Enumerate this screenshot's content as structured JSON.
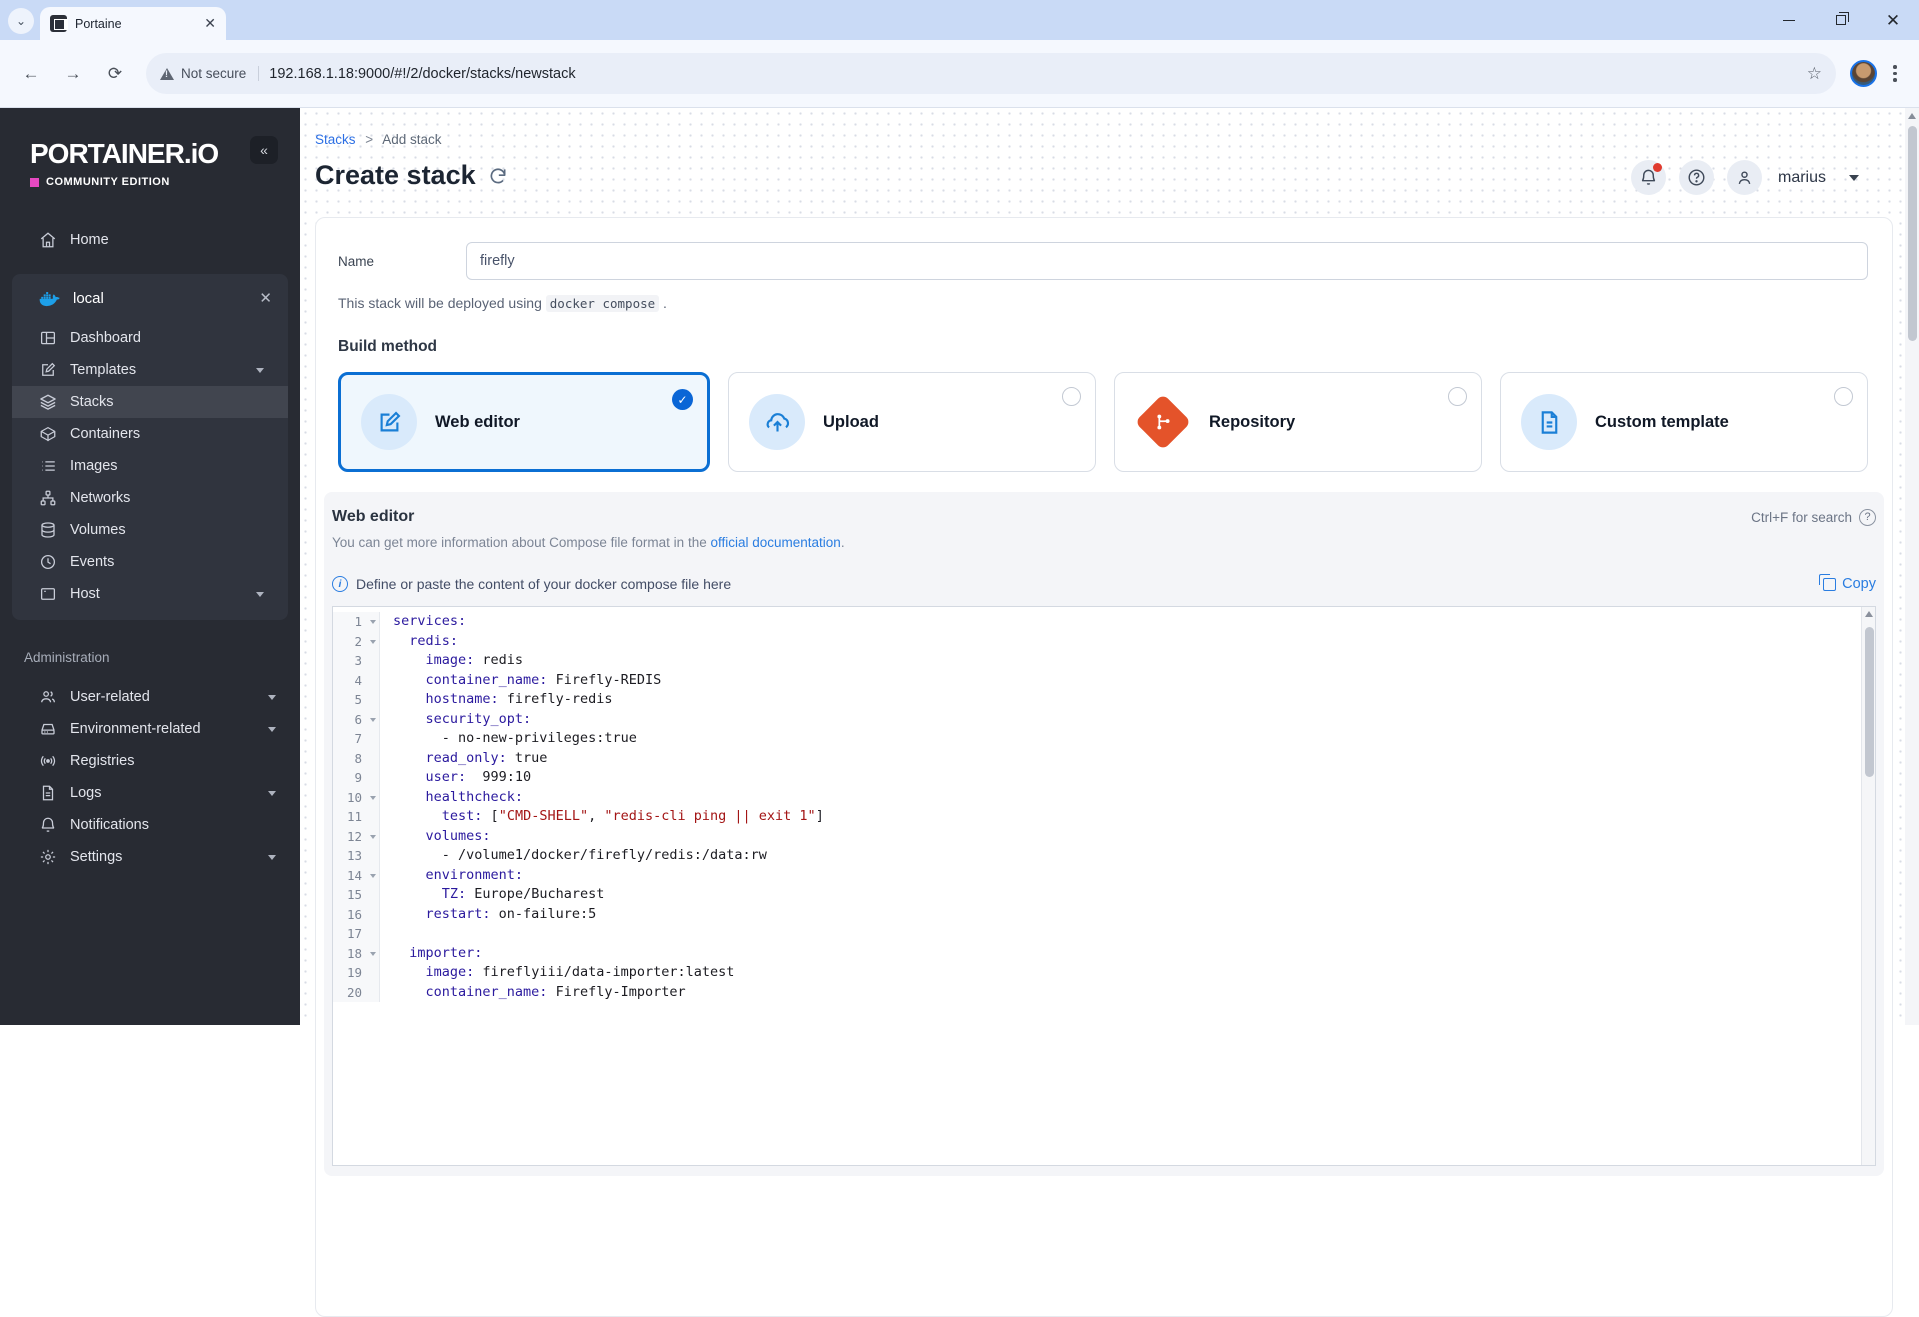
{
  "browser": {
    "tab_title": "Portaine",
    "not_secure": "Not secure",
    "url": "192.168.1.18:9000/#!/2/docker/stacks/newstack"
  },
  "sidebar": {
    "logo": "PORTAINER.iO",
    "edition": "COMMUNITY EDITION",
    "home": "Home",
    "env_name": "local",
    "env_items": [
      {
        "label": "Dashboard",
        "icon": "dashboard"
      },
      {
        "label": "Templates",
        "icon": "templates",
        "chevron": true
      },
      {
        "label": "Stacks",
        "icon": "stacks",
        "active": true
      },
      {
        "label": "Containers",
        "icon": "containers"
      },
      {
        "label": "Images",
        "icon": "images"
      },
      {
        "label": "Networks",
        "icon": "networks"
      },
      {
        "label": "Volumes",
        "icon": "volumes"
      },
      {
        "label": "Events",
        "icon": "events"
      },
      {
        "label": "Host",
        "icon": "host",
        "chevron": true
      }
    ],
    "admin_label": "Administration",
    "admin_items": [
      {
        "label": "User-related",
        "icon": "users",
        "chevron": true
      },
      {
        "label": "Environment-related",
        "icon": "environments",
        "chevron": true
      },
      {
        "label": "Registries",
        "icon": "registries"
      },
      {
        "label": "Logs",
        "icon": "logs",
        "chevron": true
      },
      {
        "label": "Notifications",
        "icon": "notifications"
      },
      {
        "label": "Settings",
        "icon": "settings",
        "chevron": true
      }
    ]
  },
  "header": {
    "breadcrumb_root": "Stacks",
    "breadcrumb_sep": ">",
    "breadcrumb_current": "Add stack",
    "title": "Create stack",
    "user": "marius"
  },
  "form": {
    "name_label": "Name",
    "name_value": "firefly",
    "deploy_prefix": "This stack will be deployed using ",
    "deploy_code": "docker compose",
    "deploy_suffix": " .",
    "build_method_label": "Build method",
    "methods": [
      {
        "label": "Web editor",
        "icon": "pencil",
        "selected": true
      },
      {
        "label": "Upload",
        "icon": "upload"
      },
      {
        "label": "Repository",
        "icon": "git"
      },
      {
        "label": "Custom template",
        "icon": "doc"
      }
    ]
  },
  "editor": {
    "title": "Web editor",
    "search_hint": "Ctrl+F for search",
    "info_prefix": "You can get more information about Compose file format in the ",
    "info_link": "official documentation",
    "info_suffix": ".",
    "instruction": "Define or paste the content of your docker compose file here",
    "copy_label": "Copy",
    "lines": [
      {
        "n": 1,
        "fold": true,
        "t": [
          [
            "k",
            "services:"
          ]
        ]
      },
      {
        "n": 2,
        "fold": true,
        "t": [
          [
            "t",
            "  "
          ],
          [
            "k",
            "redis:"
          ]
        ]
      },
      {
        "n": 3,
        "fold": false,
        "t": [
          [
            "t",
            "    "
          ],
          [
            "k",
            "image:"
          ],
          [
            "t",
            " redis"
          ]
        ]
      },
      {
        "n": 4,
        "fold": false,
        "t": [
          [
            "t",
            "    "
          ],
          [
            "k",
            "container_name:"
          ],
          [
            "t",
            " Firefly-REDIS"
          ]
        ]
      },
      {
        "n": 5,
        "fold": false,
        "t": [
          [
            "t",
            "    "
          ],
          [
            "k",
            "hostname:"
          ],
          [
            "t",
            " firefly-redis"
          ]
        ]
      },
      {
        "n": 6,
        "fold": true,
        "t": [
          [
            "t",
            "    "
          ],
          [
            "k",
            "security_opt:"
          ]
        ]
      },
      {
        "n": 7,
        "fold": false,
        "t": [
          [
            "t",
            "      - no-new-privileges:true"
          ]
        ]
      },
      {
        "n": 8,
        "fold": false,
        "t": [
          [
            "t",
            "    "
          ],
          [
            "k",
            "read_only:"
          ],
          [
            "t",
            " true"
          ]
        ]
      },
      {
        "n": 9,
        "fold": false,
        "t": [
          [
            "t",
            "    "
          ],
          [
            "k",
            "user:"
          ],
          [
            "t",
            "  999:10"
          ]
        ]
      },
      {
        "n": 10,
        "fold": true,
        "t": [
          [
            "t",
            "    "
          ],
          [
            "k",
            "healthcheck:"
          ]
        ]
      },
      {
        "n": 11,
        "fold": false,
        "t": [
          [
            "t",
            "      "
          ],
          [
            "k",
            "test:"
          ],
          [
            "t",
            " ["
          ],
          [
            "s",
            "\"CMD-SHELL\""
          ],
          [
            "t",
            ", "
          ],
          [
            "s",
            "\"redis-cli ping || exit 1\""
          ],
          [
            "t",
            "]"
          ]
        ]
      },
      {
        "n": 12,
        "fold": true,
        "t": [
          [
            "t",
            "    "
          ],
          [
            "k",
            "volumes:"
          ]
        ]
      },
      {
        "n": 13,
        "fold": false,
        "t": [
          [
            "t",
            "      - /volume1/docker/firefly/redis:/data:rw"
          ]
        ]
      },
      {
        "n": 14,
        "fold": true,
        "t": [
          [
            "t",
            "    "
          ],
          [
            "k",
            "environment:"
          ]
        ]
      },
      {
        "n": 15,
        "fold": false,
        "t": [
          [
            "t",
            "      "
          ],
          [
            "k",
            "TZ:"
          ],
          [
            "t",
            " Europe/Bucharest"
          ]
        ]
      },
      {
        "n": 16,
        "fold": false,
        "t": [
          [
            "t",
            "    "
          ],
          [
            "k",
            "restart:"
          ],
          [
            "t",
            " on-failure:5"
          ]
        ]
      },
      {
        "n": 17,
        "fold": false,
        "t": []
      },
      {
        "n": 18,
        "fold": true,
        "t": [
          [
            "t",
            "  "
          ],
          [
            "k",
            "importer:"
          ]
        ]
      },
      {
        "n": 19,
        "fold": false,
        "t": [
          [
            "t",
            "    "
          ],
          [
            "k",
            "image:"
          ],
          [
            "t",
            " fireflyiii/data-importer:latest"
          ]
        ]
      },
      {
        "n": 20,
        "fold": false,
        "t": [
          [
            "t",
            "    "
          ],
          [
            "k",
            "container_name:"
          ],
          [
            "t",
            " Firefly-Importer"
          ]
        ]
      }
    ]
  },
  "colors": {
    "accent_blue": "#0b6fd3",
    "link_blue": "#2a7de1",
    "sidebar_bg": "#282b33",
    "logo_pink": "#e649c2",
    "docker_blue": "#1d9fe8",
    "repo_orange": "#e4532a",
    "yaml_key": "#2b1a9e",
    "yaml_string": "#a31515",
    "notification_red": "#e03b2f"
  }
}
